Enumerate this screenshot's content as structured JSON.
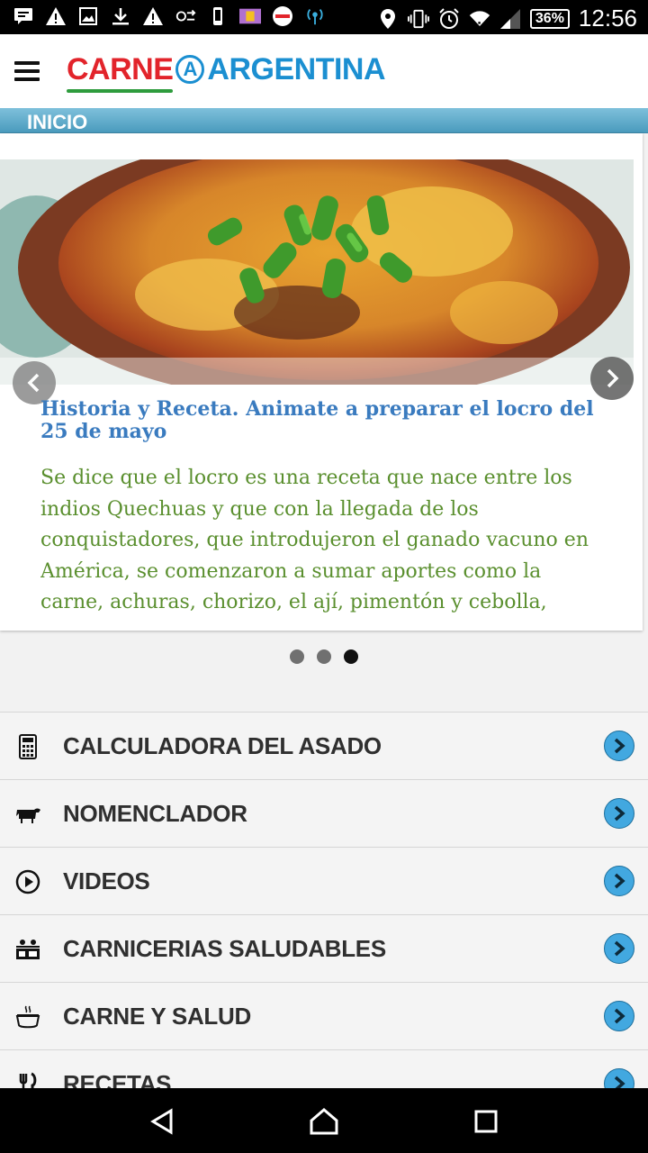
{
  "status_bar": {
    "battery": "36%",
    "time": "12:56",
    "left_icons": [
      "message-icon",
      "warning-icon",
      "image-icon",
      "download-icon",
      "warning-icon",
      "sync-icon",
      "phone-icon",
      "parking-icon",
      "app-icon",
      "hotspot-icon"
    ],
    "right_icons": [
      "location-icon",
      "vibrate-icon",
      "alarm-icon",
      "wifi-icon",
      "signal-icon"
    ]
  },
  "header": {
    "logo_part1": "CARNE",
    "logo_mark": "A",
    "logo_part2": "ARGENTINA",
    "colors": {
      "red": "#e2242b",
      "blue": "#1b8fd1",
      "green": "#2e9c3d"
    }
  },
  "section": {
    "title": "INICIO"
  },
  "slider": {
    "title": "Historia y Receta. Animate a preparar el locro del 25 de mayo",
    "body": "Se dice que el locro es una receta que nace entre los indios Quechuas y que con la llegada de los conquistadores, que introdujeron el ganado vacuno en América, se comenzaron a sumar aportes como la carne, achuras, chorizo, el ají, pimentón y cebolla,",
    "dots_total": 3,
    "active_dot": 3
  },
  "menu": [
    {
      "label": "CALCULADORA DEL ASADO",
      "icon": "calculator-icon"
    },
    {
      "label": "NOMENCLADOR",
      "icon": "cow-icon"
    },
    {
      "label": "VIDEOS",
      "icon": "play-icon"
    },
    {
      "label": "CARNICERIAS SALUDABLES",
      "icon": "butcher-shop-icon"
    },
    {
      "label": "CARNE Y SALUD",
      "icon": "steaming-bowl-icon"
    },
    {
      "label": "RECETAS",
      "icon": "fork-knife-icon"
    }
  ],
  "accent_color": "#42a8e0"
}
